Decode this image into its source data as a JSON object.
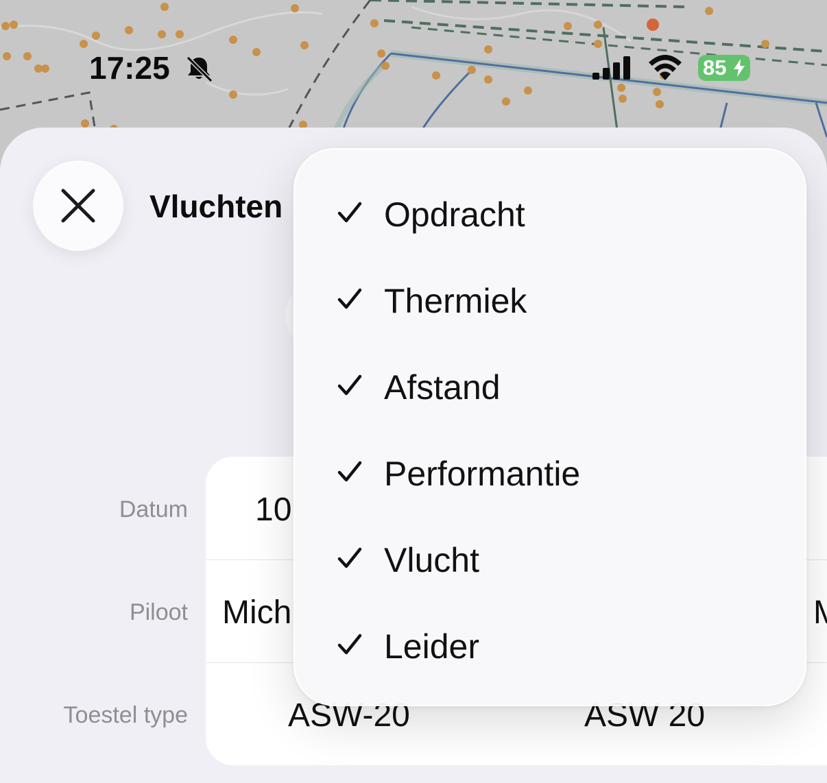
{
  "status_bar": {
    "time": "17:25",
    "battery_level": "85",
    "icons": [
      "bell-slash-icon",
      "cellular-signal-icon",
      "wifi-icon",
      "battery-charging-icon"
    ]
  },
  "sheet": {
    "title": "Vluchten"
  },
  "table": {
    "rows": [
      {
        "label": "Datum",
        "values": [
          "10",
          "",
          ""
        ]
      },
      {
        "label": "Piloot",
        "values": [
          "Mich",
          "",
          "M"
        ]
      },
      {
        "label": "Toestel type",
        "values": [
          "ASW-20",
          "ASW 20"
        ]
      }
    ]
  },
  "menu": {
    "items": [
      {
        "label": "Opdracht",
        "checked": true
      },
      {
        "label": "Thermiek",
        "checked": true
      },
      {
        "label": "Afstand",
        "checked": true
      },
      {
        "label": "Performantie",
        "checked": true
      },
      {
        "label": "Vlucht",
        "checked": true
      },
      {
        "label": "Leider",
        "checked": true
      }
    ]
  },
  "colors": {
    "sheet_background": "#f0eff5",
    "battery": "#62c36c",
    "map_dot": "#c8924a",
    "map_route": "#4f6f9e"
  }
}
